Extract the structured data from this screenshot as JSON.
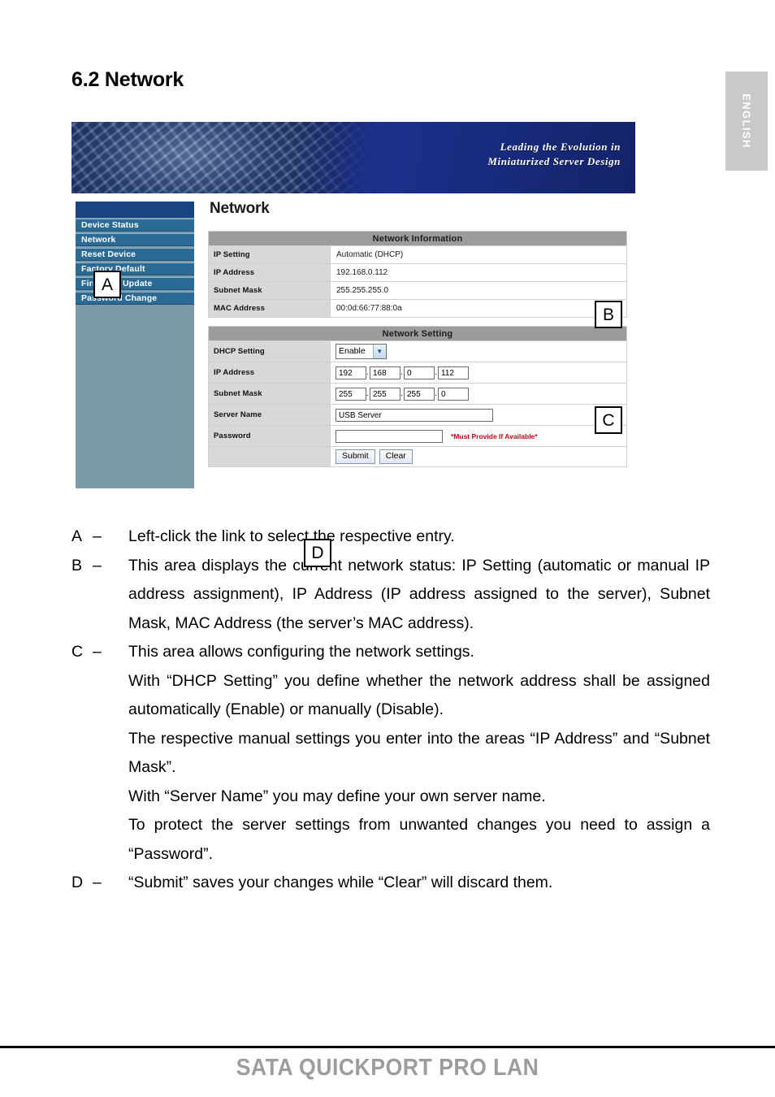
{
  "language_tab": {
    "label": "ENGLISH"
  },
  "section": {
    "title": "6.2 Network"
  },
  "screenshot": {
    "banner": {
      "tagline_line1": "Leading the Evolution in",
      "tagline_line2": "Miniaturized Server Design"
    },
    "sidebar": {
      "items": [
        {
          "label": "Device Status"
        },
        {
          "label": "Network"
        },
        {
          "label": "Reset Device"
        },
        {
          "label": "Factory Default"
        },
        {
          "label": "Firmware Update"
        },
        {
          "label": "Password Change"
        }
      ]
    },
    "page_heading": "Network",
    "network_information": {
      "title": "Network Information",
      "rows": [
        {
          "label": "IP Setting",
          "value": "Automatic (DHCP)"
        },
        {
          "label": "IP Address",
          "value": "192.168.0.112"
        },
        {
          "label": "Subnet Mask",
          "value": "255.255.255.0"
        },
        {
          "label": "MAC Address",
          "value": "00:0d:66:77:88:0a"
        }
      ]
    },
    "network_setting": {
      "title": "Network Setting",
      "dhcp": {
        "label": "DHCP Setting",
        "value": "Enable",
        "arrow_icon": "chevron-down-icon"
      },
      "ip_address": {
        "label": "IP Address",
        "octets": [
          "192",
          "168",
          "0",
          "112"
        ]
      },
      "subnet_mask": {
        "label": "Subnet Mask",
        "octets": [
          "255",
          "255",
          "255",
          "0"
        ]
      },
      "server_name": {
        "label": "Server Name",
        "value": "USB Server"
      },
      "password": {
        "label": "Password",
        "value": "",
        "hint": "*Must Provide If Available*"
      },
      "buttons": {
        "submit": "Submit",
        "clear": "Clear"
      }
    },
    "callouts": {
      "a": "A",
      "b": "B",
      "c": "C",
      "d": "D"
    }
  },
  "legend": {
    "rows": [
      {
        "key": "A",
        "dash": "–",
        "paragraphs": [
          "Left-click the link to select the respective entry."
        ]
      },
      {
        "key": "B",
        "dash": "–",
        "paragraphs": [
          "This area displays the current network status: IP Setting (automatic or manual IP address assignment), IP Address (IP address assigned to the server), Subnet Mask, MAC Address (the server’s MAC address)."
        ]
      },
      {
        "key": "C",
        "dash": "–",
        "paragraphs": [
          "This area allows configuring the network settings.",
          "With “DHCP Setting” you define whether the network address shall be assigned automatically (Enable) or manually (Disable).",
          "The respective manual settings you enter into the areas “IP Address” and “Subnet Mask”.",
          "With “Server Name” you may define your own server name.",
          "To protect the server settings from unwanted changes you need to assign a “Password”."
        ]
      },
      {
        "key": "D",
        "dash": "–",
        "paragraphs": [
          "“Submit” saves your changes while “Clear” will discard them."
        ]
      }
    ]
  },
  "footer": {
    "title": "SATA QUICKPORT PRO LAN"
  },
  "colors": {
    "banner_blue": "#1c2f8a",
    "sidebar_bg": "#7d9aa7",
    "sidebar_header": "#19447f",
    "menu_item": "#2c6a96",
    "panel_header_gray": "#9c9c9c",
    "label_gray": "#d8d8d8",
    "hint_red": "#d0021b",
    "footer_gray": "#9d9d9d",
    "lang_tab_gray": "#c8c9ca"
  }
}
